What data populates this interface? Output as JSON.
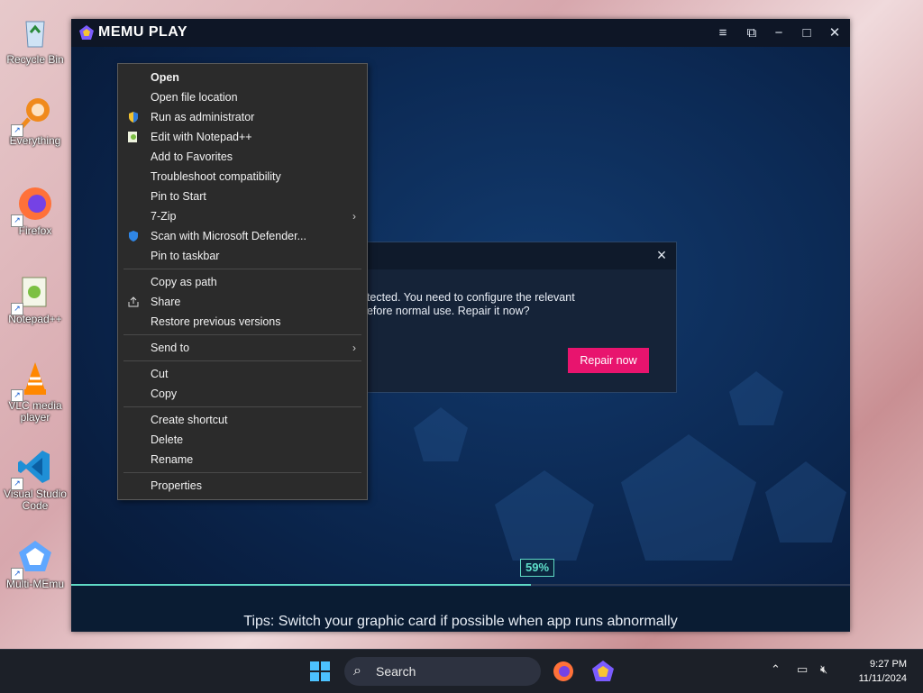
{
  "desktop": {
    "icons": [
      {
        "label": "Recycle Bin",
        "icon": "recycle-bin-icon"
      },
      {
        "label": "Everything",
        "icon": "search-magnifier-icon"
      },
      {
        "label": "Firefox",
        "icon": "firefox-icon"
      },
      {
        "label": "Notepad++",
        "icon": "notepad-plus-plus-icon"
      },
      {
        "label": "VLC media player",
        "icon": "vlc-icon"
      },
      {
        "label": "Visual Studio Code",
        "icon": "vscode-icon"
      },
      {
        "label": "Multi-MEmu",
        "icon": "multi-memu-icon"
      }
    ]
  },
  "memu": {
    "title": "MEMU PLAY",
    "controls": [
      "menu",
      "screen",
      "minimize",
      "maximize",
      "close"
    ],
    "dialog": {
      "message_line1": "etected. You need to configure the relevant",
      "message_line2": "before normal use. Repair it now?",
      "button": "Repair now",
      "close": "×"
    },
    "progress": {
      "label": "59%",
      "value": 0.59
    },
    "tips": "Tips: Switch your graphic card if possible when app runs abnormally"
  },
  "context_menu": {
    "groups": [
      [
        {
          "label": "Open",
          "bold": true
        },
        {
          "label": "Open file location"
        },
        {
          "label": "Run as administrator",
          "icon": "shield-icon"
        },
        {
          "label": "Edit with Notepad++",
          "icon": "notepad-plus-plus-icon"
        },
        {
          "label": "Add to Favorites"
        },
        {
          "label": "Troubleshoot compatibility"
        },
        {
          "label": "Pin to Start"
        },
        {
          "label": "7-Zip",
          "submenu": true
        },
        {
          "label": "Scan with Microsoft Defender...",
          "icon": "defender-icon"
        },
        {
          "label": "Pin to taskbar"
        }
      ],
      [
        {
          "label": "Copy as path"
        },
        {
          "label": "Share",
          "icon": "share-icon"
        },
        {
          "label": "Restore previous versions"
        }
      ],
      [
        {
          "label": "Send to",
          "submenu": true
        }
      ],
      [
        {
          "label": "Cut"
        },
        {
          "label": "Copy"
        }
      ],
      [
        {
          "label": "Create shortcut"
        },
        {
          "label": "Delete"
        },
        {
          "label": "Rename"
        }
      ],
      [
        {
          "label": "Properties"
        }
      ]
    ]
  },
  "taskbar": {
    "search_placeholder": "Search",
    "time": "9:27 PM",
    "date": "11/11/2024"
  }
}
